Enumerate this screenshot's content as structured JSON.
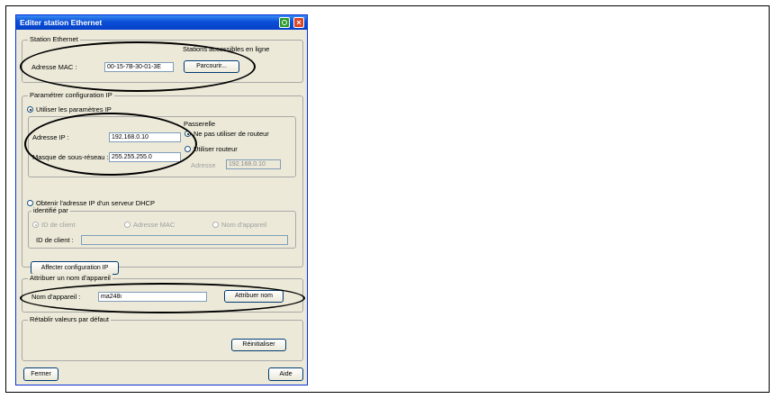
{
  "window": {
    "title": "Editer station Ethernet"
  },
  "ethernet_station": {
    "legend": "Station Ethernet",
    "online_label": "Stations accessibles en ligne",
    "mac_label": "Adresse MAC :",
    "mac_value": "00-15-7B-30-01-3E",
    "browse_button": "Parcourir..."
  },
  "ip_config": {
    "legend": "Paramétrer configuration IP",
    "use_ip_params": "Utiliser les paramètres IP",
    "ip_label": "Adresse IP :",
    "ip_value": "192.168.0.10",
    "subnet_label": "Masque de sous-réseau :",
    "subnet_value": "255.255.255.0",
    "gateway_legend": "Passerelle",
    "no_router": "Ne pas utiliser de routeur",
    "use_router": "Utiliser routeur",
    "router_address_label": "Adresse",
    "router_address_value": "192.168.0.10",
    "dhcp_option": "Obtenir l'adresse IP d'un serveur DHCP",
    "identified_by": "identifié par",
    "client_id_option": "ID de client",
    "mac_option": "Adresse MAC",
    "device_name_option": "Nom d'appareil",
    "client_id_label": "ID de client :",
    "client_id_value": "",
    "assign_ip_button": "Affecter configuration IP"
  },
  "device_name": {
    "legend": "Attribuer un nom d'appareil",
    "name_label": "Nom d'appareil :",
    "name_value": "ma248i",
    "assign_button": "Attribuer nom"
  },
  "reset": {
    "legend": "Rétablir valeurs par défaut",
    "reset_button": "Réinitialiser"
  },
  "footer": {
    "close_button": "Fermer",
    "help_button": "Aide"
  }
}
